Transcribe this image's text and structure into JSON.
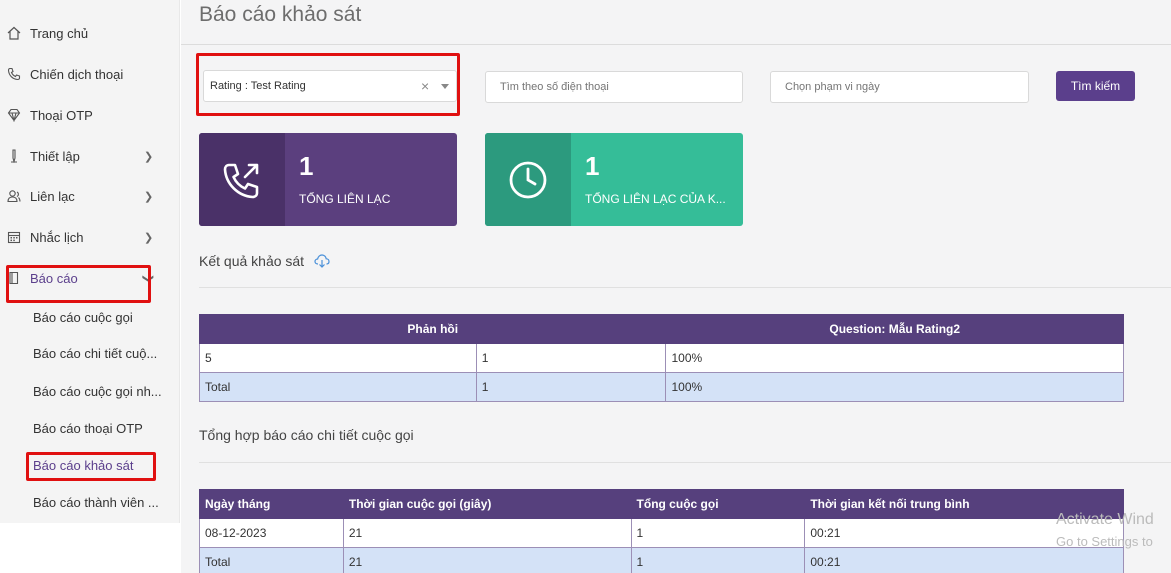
{
  "sidebar": {
    "items": [
      {
        "label": "Trang chủ"
      },
      {
        "label": "Chiến dịch thoại"
      },
      {
        "label": "Thoại OTP"
      },
      {
        "label": "Thiết lập"
      },
      {
        "label": "Liên lạc"
      },
      {
        "label": "Nhắc lịch"
      },
      {
        "label": "Báo cáo"
      }
    ],
    "subitems": [
      {
        "label": "Báo cáo cuộc gọi"
      },
      {
        "label": "Báo cáo chi tiết cuộ..."
      },
      {
        "label": "Báo cáo cuộc gọi nh..."
      },
      {
        "label": "Báo cáo thoại OTP"
      },
      {
        "label": "Báo cáo khảo sát"
      },
      {
        "label": "Báo cáo thành viên ..."
      }
    ]
  },
  "page": {
    "title": "Báo cáo khảo sát"
  },
  "filters": {
    "survey_select_value": "Rating : Test Rating",
    "clear_glyph": "×",
    "phone_placeholder": "Tìm theo số điện thoại",
    "date_placeholder": "Chọn phạm vi ngày",
    "search_label": "Tìm kiếm"
  },
  "cards": [
    {
      "value": "1",
      "caption": "TỔNG LIÊN LẠC",
      "icon": "phone-outgoing-icon",
      "color": "#5b3f7e"
    },
    {
      "value": "1",
      "caption": "TỔNG LIÊN LẠC CỦA K...",
      "icon": "clock-icon",
      "color": "#35bd98"
    }
  ],
  "survey_results": {
    "title": "Kết quả khảo sát",
    "headers": [
      "Phản hồi",
      "Question: Mẫu Rating2"
    ],
    "rows": [
      [
        "5",
        "1",
        "100%"
      ],
      [
        "Total",
        "1",
        "100%"
      ]
    ]
  },
  "call_summary": {
    "title": "Tổng hợp báo cáo chi tiết cuộc gọi",
    "headers": [
      "Ngày tháng",
      "Thời gian cuộc gọi (giây)",
      "Tổng cuộc gọi",
      "Thời gian kết nối trung bình"
    ],
    "rows": [
      [
        "08-12-2023",
        "21",
        "1",
        "00:21"
      ],
      [
        "Total",
        "21",
        "1",
        "00:21"
      ]
    ]
  },
  "watermark": {
    "line1": "Activate Wind",
    "line2": "Go to Settings to"
  },
  "colors": {
    "accent": "#5b3f8c",
    "highlight": "#e01010",
    "total_row": "#d4e2f7"
  }
}
